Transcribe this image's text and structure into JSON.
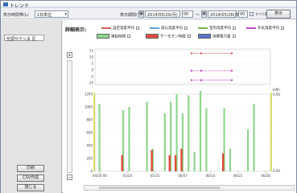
{
  "window": {
    "title": "トレンド"
  },
  "toolbar": {
    "period_label": "表示時間帯(L)",
    "period_value": "1日単位",
    "range_label": "表示期間(T)",
    "start_date": "2014/05/20(月)",
    "start_hour": "00",
    "end_date": "2014/05/26(日)",
    "end_hour": "00",
    "all_label": "すべて表示",
    "show_button": "表示"
  },
  "left": {
    "chip_label": "空調サテソ夫 区",
    "buttons": [
      "印刷",
      "CSV作成",
      "閉じる"
    ]
  },
  "legend": {
    "title": "詳細表示:",
    "lines": [
      {
        "label": "設定温度平均",
        "color": "#e05a5a"
      },
      {
        "label": "吸込温度平均",
        "color": "#66a3d9"
      },
      {
        "label": "室内温度平均",
        "color": "#7ab648"
      },
      {
        "label": "外気温度平均",
        "color": "#c04fc0"
      }
    ],
    "boxes": [
      {
        "label": "運転時間",
        "color": "#8fd68f"
      },
      {
        "label": "サーモオン時間",
        "color": "#e04a3a"
      },
      {
        "label": "消費電力量",
        "color": "#5a78c8"
      }
    ]
  },
  "chart_data": [
    {
      "type": "line",
      "title": "",
      "ylim": [
        -12,
        12
      ],
      "yticks": [
        "12",
        "10",
        "5",
        "0",
        "-5",
        "-10"
      ],
      "series": [
        {
          "color": "#e05a5a",
          "values": [
            10,
            10,
            10
          ]
        },
        {
          "color": "#c04fc0",
          "values": [
            -3,
            -3,
            -3
          ]
        },
        {
          "color": "#c04fc0",
          "values": [
            -10,
            -10,
            -10
          ]
        }
      ],
      "x": [
        "05/27",
        "05/28",
        "05/29"
      ]
    },
    {
      "type": "bar",
      "ylim": [
        0,
        1200
      ],
      "left_ticks": [
        "1200",
        "1000",
        "800",
        "600",
        "400",
        "200",
        "0"
      ],
      "right_label": "kWh",
      "right_top": "0.00",
      "right_bottom": "0.00",
      "x_ticks": [
        "04/20 00",
        "05/24",
        "05/31",
        "06/07",
        "06/14",
        "06/21",
        "06/28"
      ],
      "series": [
        {
          "name": "運転時間",
          "color": "#8fd68f",
          "values": [
            1050,
            0,
            0,
            0,
            950,
            1000,
            0,
            0,
            1080,
            350,
            0,
            900,
            1080,
            1200,
            900,
            1180,
            300,
            1250,
            980,
            0,
            0,
            980,
            350,
            0,
            0,
            650,
            1050,
            0,
            0
          ]
        },
        {
          "name": "サーモオン時間",
          "color": "#e04a3a",
          "values": [
            0,
            0,
            0,
            0,
            250,
            0,
            0,
            0,
            0,
            330,
            0,
            0,
            250,
            250,
            350,
            0,
            0,
            0,
            0,
            0,
            0,
            280,
            0,
            0,
            0,
            0,
            0,
            0,
            0
          ]
        }
      ]
    }
  ]
}
